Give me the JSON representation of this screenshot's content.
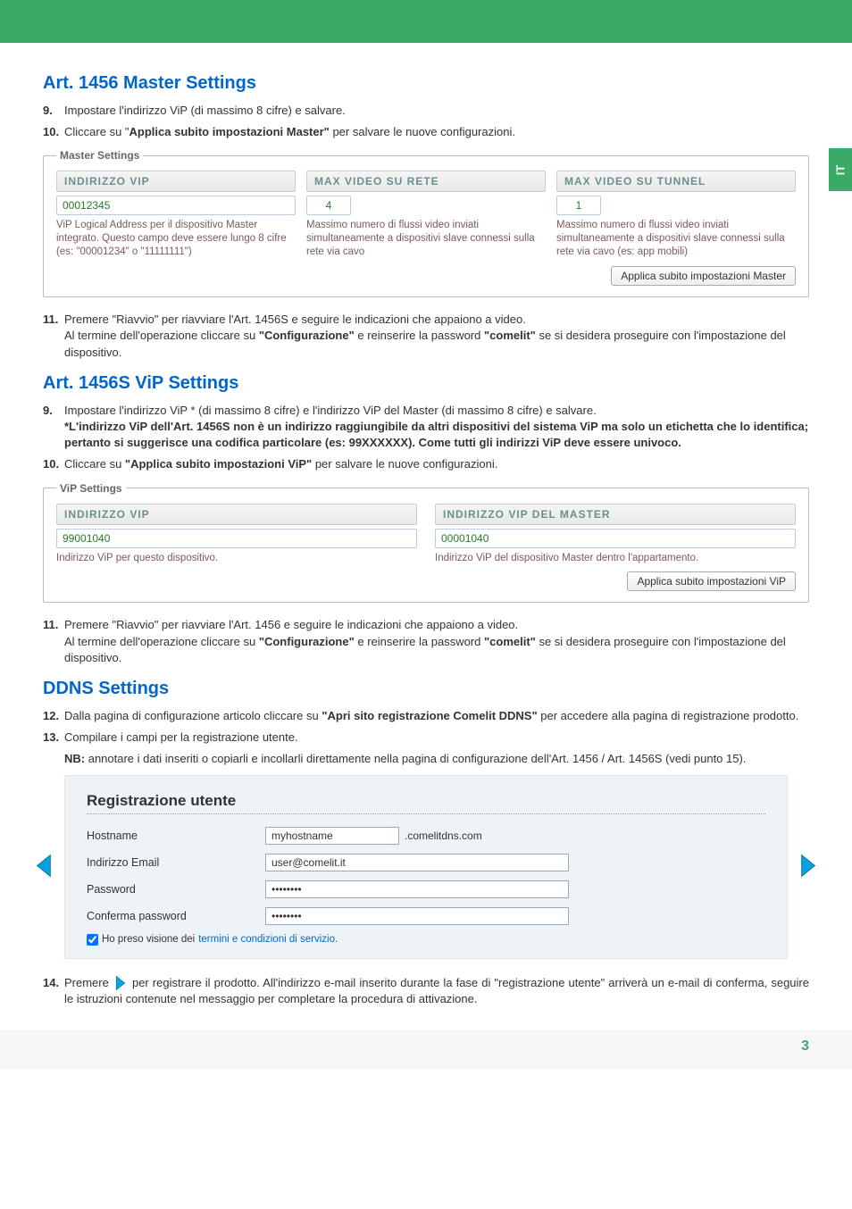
{
  "side_tab": "IT",
  "sections": {
    "master": {
      "title": "Art. 1456 Master Settings",
      "steps": {
        "s9_num": "9.",
        "s9_text": "Impostare l'indirizzo ViP (di massimo 8 cifre) e salvare.",
        "s10_num": "10.",
        "s10_pre": "Cliccare su \"",
        "s10_bold": "Applica subito impostazioni Master\"",
        "s10_post": " per salvare le nuove configurazioni.",
        "s11_num": "11.",
        "s11_line1": "Premere \"Riavvio\" per riavviare l'Art. 1456S e seguire le indicazioni che appaiono a video.",
        "s11_line2_pre": "Al termine dell'operazione cliccare su ",
        "s11_line2_b1": "\"Configurazione\"",
        "s11_line2_mid": " e reinserire la password ",
        "s11_line2_b2": "\"comelit\"",
        "s11_line2_post": " se si desidera proseguire con l'impostazione del dispositivo."
      },
      "panel": {
        "legend": "Master Settings",
        "col1": {
          "header": "INDIRIZZO VIP",
          "value": "00012345",
          "help": "ViP Logical Address per il dispositivo Master integrato. Questo campo deve essere lungo 8 cifre (es: \"00001234\" o \"11111111\")"
        },
        "col2": {
          "header": "MAX VIDEO SU RETE",
          "value": "4",
          "help": "Massimo numero di flussi video inviati simultaneamente a dispositivi slave connessi sulla rete via cavo"
        },
        "col3": {
          "header": "MAX VIDEO SU TUNNEL",
          "value": "1",
          "help": "Massimo numero di flussi video inviati simultaneamente a dispositivi slave connessi sulla rete via cavo (es: app mobili)"
        },
        "button": "Applica subito impostazioni Master"
      }
    },
    "vip": {
      "title": "Art. 1456S ViP Settings",
      "steps": {
        "s9_num": "9.",
        "s9_line1": "Impostare l'indirizzo ViP * (di massimo 8 cifre) e l'indirizzo ViP del Master (di massimo 8 cifre) e salvare.",
        "s9_note": "*L'indirizzo ViP dell'Art. 1456S non è un indirizzo raggiungibile da altri dispositivi del sistema ViP ma solo un etichetta che lo identifica; pertanto si suggerisce una codifica particolare (es: 99XXXXXX). Come tutti gli indirizzi ViP deve essere univoco.",
        "s10_num": "10.",
        "s10_pre": "Cliccare su ",
        "s10_bold": "\"Applica subito impostazioni ViP\"",
        "s10_post": " per salvare le nuove configurazioni.",
        "s11_num": "11.",
        "s11_line1": "Premere \"Riavvio\" per riavviare l'Art. 1456  e seguire le indicazioni che appaiono a video.",
        "s11_line2_pre": "Al termine dell'operazione cliccare su ",
        "s11_line2_b1": "\"Configurazione\"",
        "s11_line2_mid": " e reinserire la password ",
        "s11_line2_b2": "\"comelit\"",
        "s11_line2_post": " se si desidera proseguire con l'impostazione del dispositivo."
      },
      "panel": {
        "legend": "ViP Settings",
        "col1": {
          "header": "INDIRIZZO VIP",
          "value": "99001040",
          "help": "Indirizzo ViP per questo dispositivo."
        },
        "col2": {
          "header": "INDIRIZZO VIP DEL MASTER",
          "value": "00001040",
          "help": "Indirizzo ViP del dispositivo Master dentro l'appartamento."
        },
        "button": "Applica subito impostazioni ViP"
      }
    },
    "ddns": {
      "title": "DDNS Settings",
      "steps": {
        "s12_num": "12.",
        "s12_pre": "Dalla pagina di configurazione articolo cliccare su ",
        "s12_bold": "\"Apri sito registrazione Comelit DDNS\"",
        "s12_post": " per accedere alla pagina di registrazione prodotto.",
        "s13_num": "13.",
        "s13_text": "Compilare i campi per la registrazione utente.",
        "s13_nb_label": "NB:",
        "s13_nb_text": " annotare i dati inseriti o copiarli e incollarli direttamente nella pagina di configurazione dell'Art. 1456 / Art. 1456S (vedi punto 15).",
        "s14_num": "14.",
        "s14_pre": "Premere ",
        "s14_post": " per registrare il prodotto. All'indirizzo e-mail inserito durante la fase di \"registrazione utente\" arriverà un e-mail di conferma, seguire le istruzioni contenute nel messaggio per completare la procedura di attivazione."
      },
      "reg": {
        "title": "Registrazione utente",
        "hostname_label": "Hostname",
        "hostname_value": "myhostname",
        "hostname_suffix": ".comelitdns.com",
        "email_label": "Indirizzo Email",
        "email_value": "user@comelit.it",
        "pwd_label": "Password",
        "pwd_value": "••••••••",
        "pwd2_label": "Conferma password",
        "pwd2_value": "••••••••",
        "terms_pre": "Ho preso visione dei ",
        "terms_link": "termini e condizioni di servizio."
      }
    }
  },
  "page_number": "3"
}
